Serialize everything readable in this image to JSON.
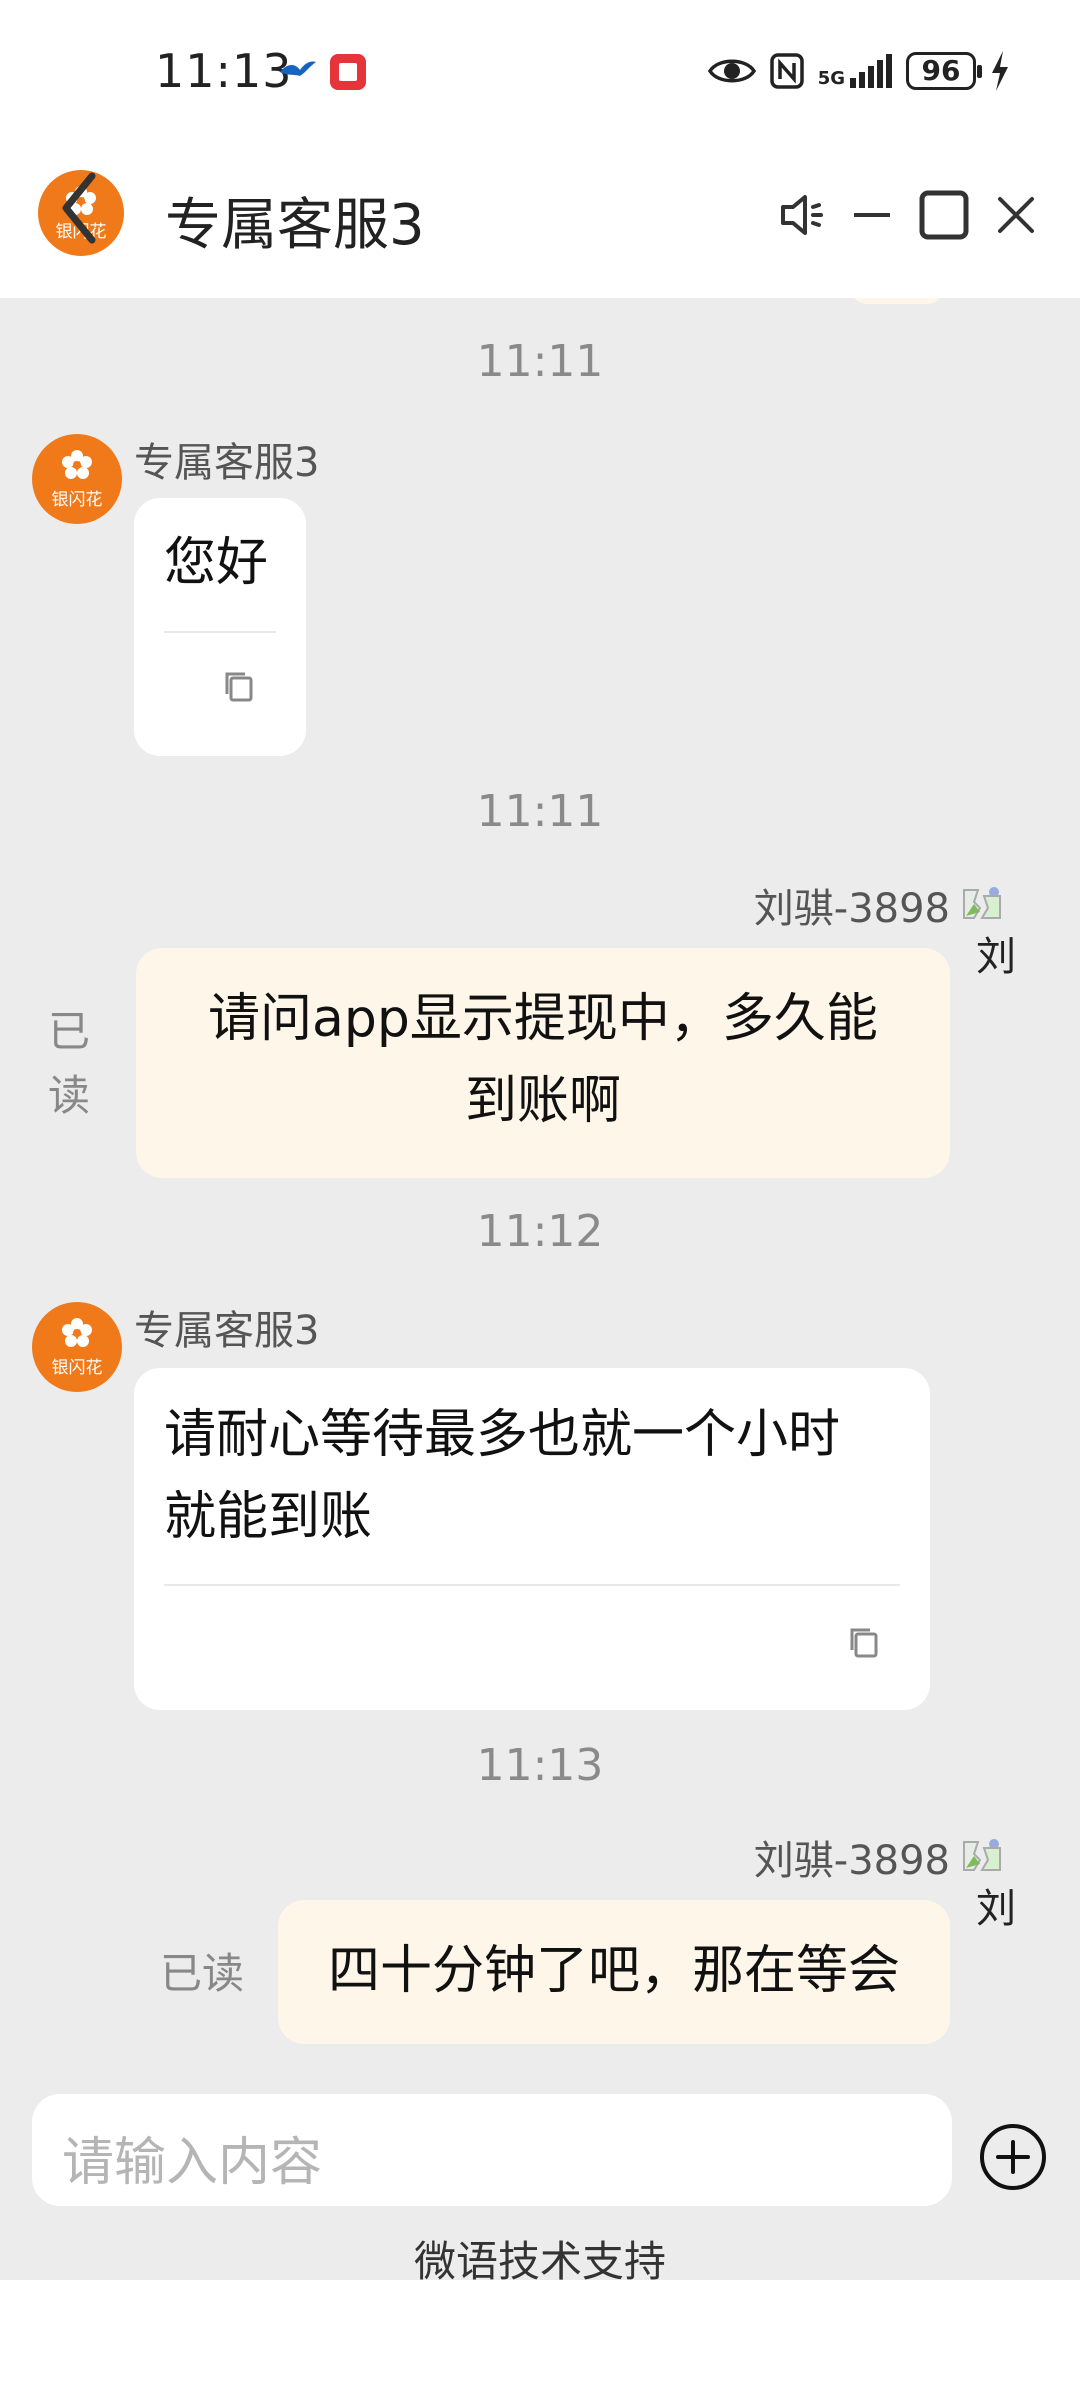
{
  "status_bar": {
    "time": "11:13",
    "network": "5G",
    "battery": "96"
  },
  "header": {
    "title": "专属客服3",
    "avatar_label": "银闪花"
  },
  "messages": [
    {
      "type": "time",
      "text": "11:11"
    },
    {
      "type": "agent",
      "sender": "专属客服3",
      "avatar_label": "银闪花",
      "text": "您好"
    },
    {
      "type": "time",
      "text": "11:11"
    },
    {
      "type": "user",
      "sender": "刘骐-3898",
      "name_glyph": "刘",
      "text_line1": "请问app显示提现中，多久能",
      "text_line2": "到账啊",
      "read_line1": "已",
      "read_line2": "读"
    },
    {
      "type": "time",
      "text": "11:12"
    },
    {
      "type": "agent",
      "sender": "专属客服3",
      "avatar_label": "银闪花",
      "text_line1": "请耐心等待最多也就一个小时",
      "text_line2": "就能到账"
    },
    {
      "type": "time",
      "text": "11:13"
    },
    {
      "type": "user",
      "sender": "刘骐-3898",
      "name_glyph": "刘",
      "text": "四十分钟了吧，那在等会",
      "read": "已读"
    }
  ],
  "input": {
    "placeholder": "请输入内容"
  },
  "footer": {
    "support_text": "微语技术支持"
  },
  "colors": {
    "accent_orange": "#f07a1a",
    "user_bubble": "#fdf6e9",
    "chat_background": "#ececec"
  }
}
